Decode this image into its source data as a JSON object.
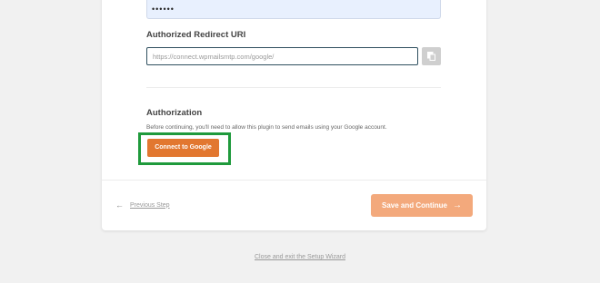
{
  "form": {
    "password_value": "••••••",
    "redirect_uri_label": "Authorized Redirect URI",
    "redirect_uri_value": "https://connect.wpmailsmtp.com/google/",
    "copy_icon": "copy-icon",
    "authorization_label": "Authorization",
    "authorization_desc": "Before continuing, you'll need to allow this plugin to send emails using your Google account.",
    "connect_button": "Connect to Google"
  },
  "footer": {
    "prev_arrow": "←",
    "prev_label": "Previous Step",
    "save_label": "Save and Continue",
    "save_arrow": "→"
  },
  "exit_link": "Close and exit the Setup Wizard",
  "colors": {
    "accent": "#e27730",
    "accent_disabled": "#f3a97c",
    "highlight": "#1f9a3c"
  }
}
